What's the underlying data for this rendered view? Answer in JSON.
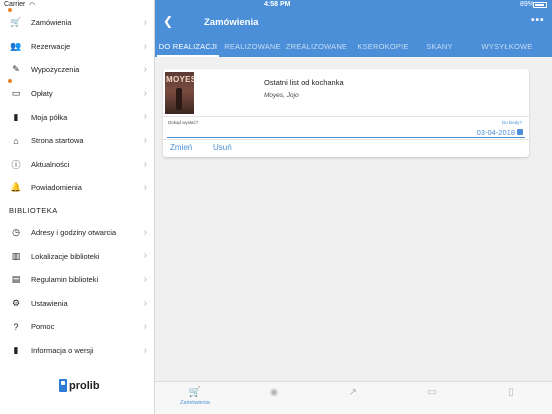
{
  "status_bar": {
    "carrier": "Carrier",
    "time": "4:58 PM",
    "battery": "89%"
  },
  "sidebar": {
    "items_top": [
      {
        "label": "Zamówienia",
        "icon": "cart-icon",
        "glyph": "🛒",
        "badge": true
      },
      {
        "label": "Rezerwacje",
        "icon": "group-icon",
        "glyph": "👥",
        "badge": false
      },
      {
        "label": "Wypożyczenia",
        "icon": "edit-icon",
        "glyph": "✎",
        "badge": false
      },
      {
        "label": "Opłaty",
        "icon": "card-icon",
        "glyph": "▭",
        "badge": true
      },
      {
        "label": "Moja półka",
        "icon": "bookmark-icon",
        "glyph": "▮",
        "badge": false
      },
      {
        "label": "Strona startowa",
        "icon": "home-icon",
        "glyph": "⌂",
        "badge": false
      },
      {
        "label": "Aktualności",
        "icon": "info-icon",
        "glyph": "ⓘ",
        "badge": false
      },
      {
        "label": "Powiadomienia",
        "icon": "bell-icon",
        "glyph": "🔔",
        "badge": false
      }
    ],
    "section_title": "BIBLIOTEKA",
    "items_bottom": [
      {
        "label": "Adresy i godziny otwarcia",
        "icon": "clock-icon",
        "glyph": "◷"
      },
      {
        "label": "Lokalizacje biblioteki",
        "icon": "map-icon",
        "glyph": "▥"
      },
      {
        "label": "Regulamin biblioteki",
        "icon": "document-icon",
        "glyph": "▤"
      },
      {
        "label": "Ustawienia",
        "icon": "gear-icon",
        "glyph": "⚙"
      },
      {
        "label": "Pomoc",
        "icon": "help-icon",
        "glyph": "?"
      },
      {
        "label": "Informacja o wersji",
        "icon": "file-icon",
        "glyph": "▮"
      }
    ],
    "logo": "prolib"
  },
  "navbar": {
    "title": "Zamówienia"
  },
  "tabs": [
    {
      "label": "DO REALIZACJI",
      "active": true
    },
    {
      "label": "REALIZOWANE",
      "active": false
    },
    {
      "label": "ZREALIZOWANE",
      "active": false
    },
    {
      "label": "KSEROKOPIE",
      "active": false
    },
    {
      "label": "SKANY",
      "active": false
    },
    {
      "label": "WYSYŁKOWE",
      "active": false
    }
  ],
  "order_card": {
    "cover_author": "MOYES",
    "title": "Ostatni list od kochanka",
    "author": "Moyes, Jojo",
    "send_label": "Dokąd wysłać?",
    "until_label": "Do kiedy?",
    "until_value": "03-04-2018",
    "edit_label": "Zmień",
    "delete_label": "Usuń"
  },
  "bottom_tabs": [
    {
      "name": "tab-orders",
      "icon": "cart-icon",
      "glyph": "🛒",
      "label": "Zamówienia",
      "active": true
    },
    {
      "name": "tab-reservations",
      "icon": "eye-icon",
      "glyph": "◉",
      "label": "",
      "active": false
    },
    {
      "name": "tab-share",
      "icon": "share-icon",
      "glyph": "↗",
      "label": "",
      "active": false
    },
    {
      "name": "tab-card",
      "icon": "card-icon",
      "glyph": "▭",
      "label": "",
      "active": false
    },
    {
      "name": "tab-bookmark",
      "icon": "bookmark-icon",
      "glyph": "▯",
      "label": "",
      "active": false
    }
  ],
  "colors": {
    "accent": "#4a8fd8",
    "badge": "#e8822b"
  }
}
